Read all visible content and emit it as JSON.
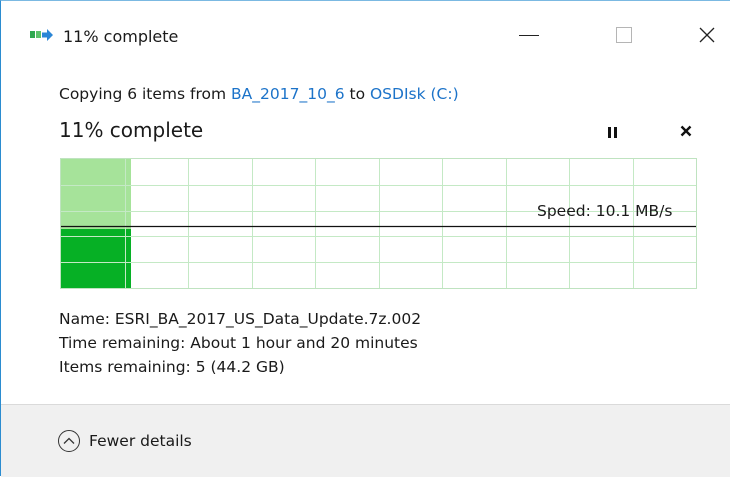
{
  "window": {
    "title": "11% complete",
    "minimize_label": "Minimize",
    "maximize_label": "Maximize",
    "close_label": "Close"
  },
  "copy": {
    "prefix": "Copying 6 items from ",
    "source": "BA_2017_10_6",
    "middle": " to ",
    "destination": "OSDIsk (C:)"
  },
  "progress": {
    "percent_label": "11% complete",
    "fraction": 0.11
  },
  "speed": {
    "label": "Speed: 10.1 MB/s"
  },
  "details": {
    "name_label": "Name: ",
    "name_value": "ESRI_BA_2017_US_Data_Update.7z.002",
    "time_label": "Time remaining: ",
    "time_value": "About 1 hour and 20 minutes",
    "items_label": "Items remaining: ",
    "items_value": "5 (44.2 GB)"
  },
  "footer": {
    "toggle_label": "Fewer details"
  },
  "colors": {
    "accent_link": "#1c73c9",
    "progress_light": "#a6e39a",
    "progress_dark": "#06b025",
    "grid": "#c4e9c5",
    "window_border": "#2b8cd0"
  },
  "icons": {
    "title_icon": "copy-transfer-icon",
    "pause_icon": "pause-icon",
    "cancel_icon": "close-icon",
    "toggle_icon": "chevron-up-circle-icon"
  }
}
